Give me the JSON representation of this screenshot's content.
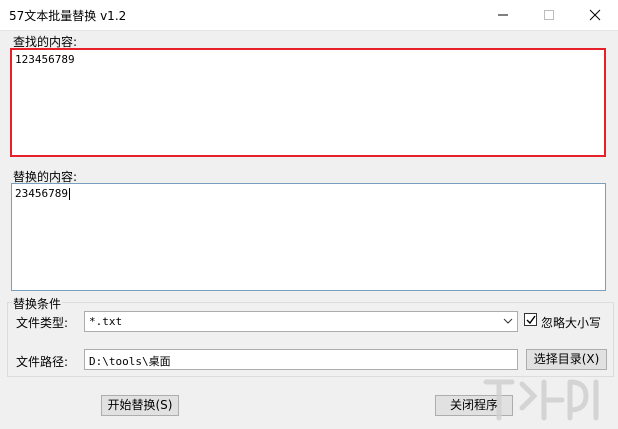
{
  "window": {
    "title": "57文本批量替换 v1.2"
  },
  "find": {
    "legend": "查找的内容:",
    "value": "123456789"
  },
  "replace": {
    "legend": "替换的内容:",
    "value": "23456789"
  },
  "conditions": {
    "legend": "替换条件",
    "file_type_label": "文件类型:",
    "file_type_value": "*.txt",
    "ignore_case_label": "忽略大小写",
    "ignore_case_checked": true,
    "file_path_label": "文件路径:",
    "file_path_value": "D:\\tools\\桌面",
    "choose_dir_label": "选择目录(X)"
  },
  "actions": {
    "start_label": "开始替换(S)",
    "close_label": "关闭程序"
  },
  "colors": {
    "find_border": "#e6212a",
    "replace_border": "#7a9ebd"
  }
}
